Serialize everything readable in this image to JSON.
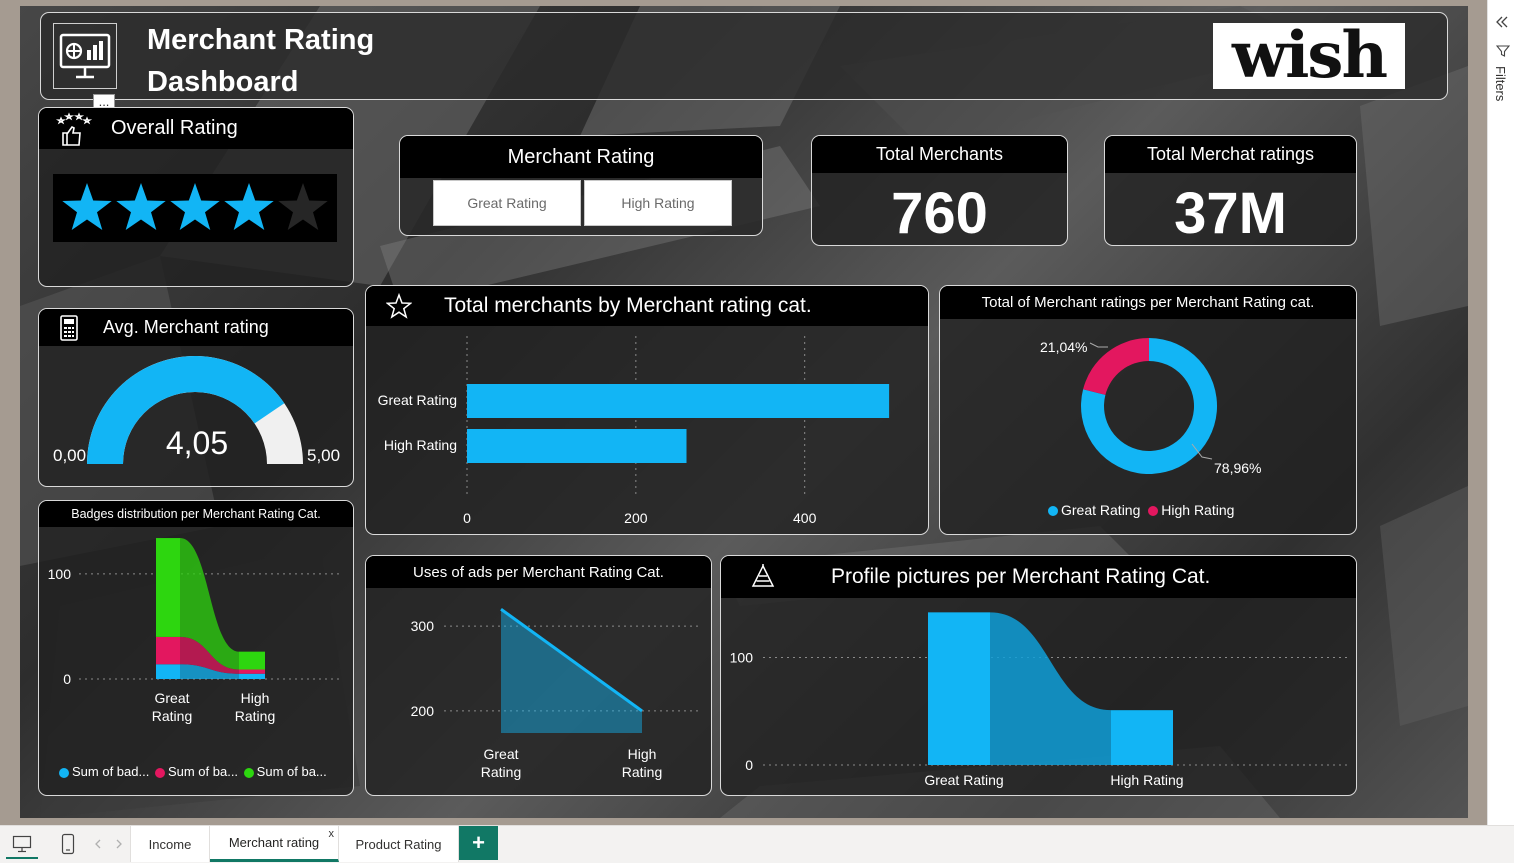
{
  "header": {
    "title_line1": "Merchant Rating",
    "title_line2": "Dashboard",
    "logo_text": "wish"
  },
  "overall_rating": {
    "title": "Overall Rating",
    "stars_filled": 4,
    "stars_total": 5
  },
  "avg_rating": {
    "title": "Avg. Merchant rating",
    "value": "4,05",
    "min": "0,00",
    "max": "5,00",
    "value_num": 4.05,
    "max_num": 5
  },
  "slicer": {
    "title": "Merchant Rating",
    "options": [
      "Great Rating",
      "High Rating"
    ]
  },
  "total_merchants": {
    "title": "Total Merchants",
    "value": "760"
  },
  "total_ratings": {
    "title": "Total Merchat ratings",
    "value": "37M"
  },
  "bar_chart": {
    "title": "Total merchants by Merchant rating cat."
  },
  "donut": {
    "title": "Total of Merchant ratings per Merchant Rating cat."
  },
  "badges": {
    "title": "Badges distribution per Merchant Rating Cat."
  },
  "ads": {
    "title": "Uses of ads per Merchant Rating Cat."
  },
  "profile": {
    "title": "Profile pictures per Merchant Rating Cat."
  },
  "colors": {
    "accent": "#12b5f5",
    "pink": "#e3175f",
    "green": "#2dd60f",
    "header_bg": "#000000",
    "teal": "#117865"
  },
  "chart_data": [
    {
      "type": "bar",
      "title": "Total merchants by Merchant rating cat.",
      "categories": [
        "Great Rating",
        "High Rating"
      ],
      "values": [
        500,
        260
      ],
      "xticks": [
        "0",
        "200",
        "400"
      ],
      "xlim": [
        0,
        520
      ]
    },
    {
      "type": "pie",
      "title": "Total of Merchant ratings per Merchant Rating cat.",
      "categories": [
        "Great Rating",
        "High Rating"
      ],
      "values": [
        78.96,
        21.04
      ],
      "labels": [
        "78,96%",
        "21,04%"
      ],
      "legend": [
        "Great Rating",
        "High Rating"
      ],
      "legend_position": "bottom"
    },
    {
      "type": "bar",
      "title": "Badges distribution per Merchant Rating Cat.",
      "categories": [
        "Great Rating",
        "High Rating"
      ],
      "category_labels": [
        [
          "Great",
          "Rating"
        ],
        [
          "High",
          "Rating"
        ]
      ],
      "series": [
        {
          "values": [
            14,
            5
          ]
        },
        {
          "values": [
            26,
            4
          ]
        },
        {
          "values": [
            94,
            17
          ]
        }
      ],
      "yticks": [
        "0",
        "100"
      ],
      "ylim": [
        0,
        135
      ],
      "legend": [
        "Sum of bad...",
        "Sum of ba...",
        "Sum of ba..."
      ],
      "legend_position": "bottom"
    },
    {
      "type": "area",
      "title": "Uses of ads per Merchant Rating Cat.",
      "categories": [
        "Great Rating",
        "High Rating"
      ],
      "category_labels": [
        [
          "Great",
          "Rating"
        ],
        [
          "High",
          "Rating"
        ]
      ],
      "values": [
        320,
        200
      ],
      "yticks": [
        "200",
        "300"
      ],
      "ylim": [
        115,
        345
      ]
    },
    {
      "type": "bar",
      "title": "Profile pictures per Merchant Rating Cat.",
      "categories": [
        "Great Rating",
        "High Rating"
      ],
      "values": [
        142,
        51
      ],
      "yticks": [
        "0",
        "100"
      ],
      "ylim": [
        0,
        160
      ]
    }
  ],
  "filters": {
    "label": "Filters"
  },
  "tabs": {
    "items": [
      "Income",
      "Merchant rating",
      "Product Rating"
    ],
    "add": "+",
    "close": "x"
  },
  "toolbar_more": "..."
}
